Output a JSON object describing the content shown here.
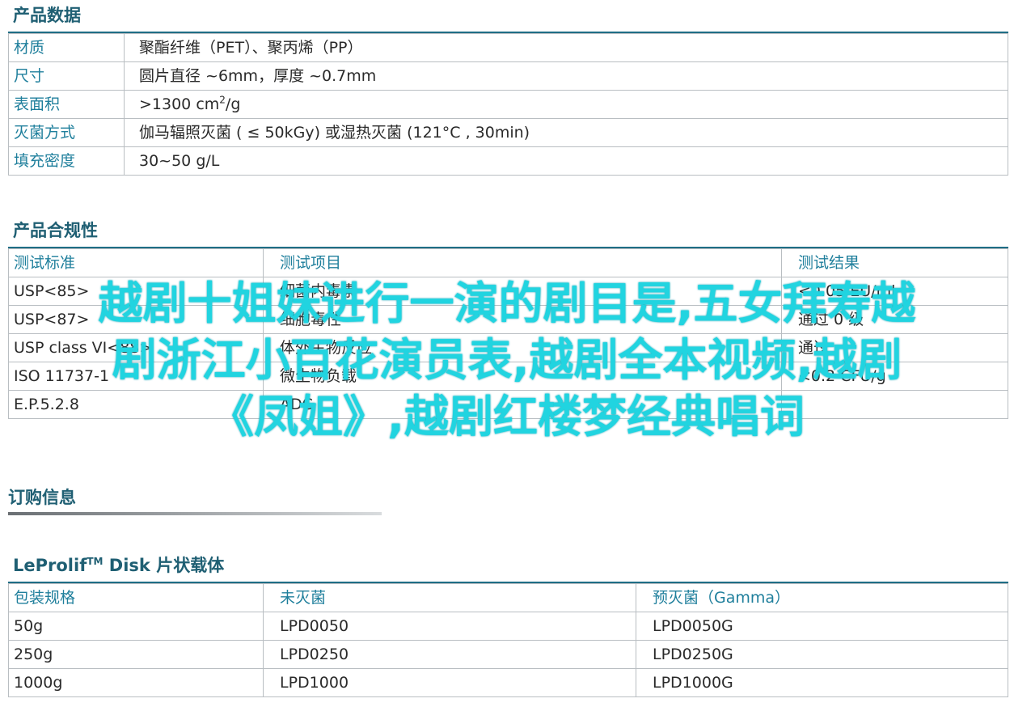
{
  "product_data": {
    "title": "产品数据",
    "rows": [
      {
        "key": "材质",
        "value": "聚酯纤维（PET）、聚丙烯（PP）"
      },
      {
        "key": "尺寸",
        "value": "圆片直径 ~6mm，厚度 ~0.7mm"
      },
      {
        "key": "表面积",
        "value_pre": ">1300 cm",
        "value_sup": "2",
        "value_post": "/g"
      },
      {
        "key": "灭菌方式",
        "value": "伽马辐照灭菌 ( ≤ 50kGy) 或湿热灭菌 (121°C , 30min)"
      },
      {
        "key": "填充密度",
        "value": "30~50 g/L"
      }
    ]
  },
  "compliance": {
    "title": "产品合规性",
    "headers": [
      "测试标准",
      "测试项目",
      "测试结果"
    ],
    "rows": [
      [
        "USP<85>",
        "细菌内毒素",
        "<0.05 EU/ml"
      ],
      [
        "USP<87>",
        "细胞毒性",
        "通过 0 级"
      ],
      [
        "USP class VI<88>",
        "体外生物反应",
        "通过"
      ],
      [
        "ISO 11737-1",
        "微生物负载",
        "<0.2 CFU/g"
      ],
      [
        "E.P.5.2.8",
        "ADC",
        ""
      ]
    ]
  },
  "order_info": {
    "title": "订购信息"
  },
  "disk_table": {
    "title_pre": "LeProlif",
    "title_sup": "TM",
    "title_post": " Disk 片状载体",
    "headers": [
      "包装规格",
      "未灭菌",
      "预灭菌（Gamma）"
    ],
    "rows": [
      [
        "50g",
        "LPD0050",
        "LPD0050G"
      ],
      [
        "250g",
        "LPD0250",
        "LPD0250G"
      ],
      [
        "1000g",
        "LPD1000",
        "LPD1000G"
      ]
    ]
  },
  "overlay": {
    "line1": "越剧十姐妹进行一演的剧目是,五女拜寿越",
    "line2": "剧浙江小百花演员表,越剧全本视频,越剧",
    "line3": "《凤姐》,越剧红楼梦经典唱词"
  },
  "colors": {
    "heading": "#1f5f73",
    "key_text": "#1f7f9c",
    "rule": "#1f6e86",
    "overlay": "#21d4e0"
  }
}
